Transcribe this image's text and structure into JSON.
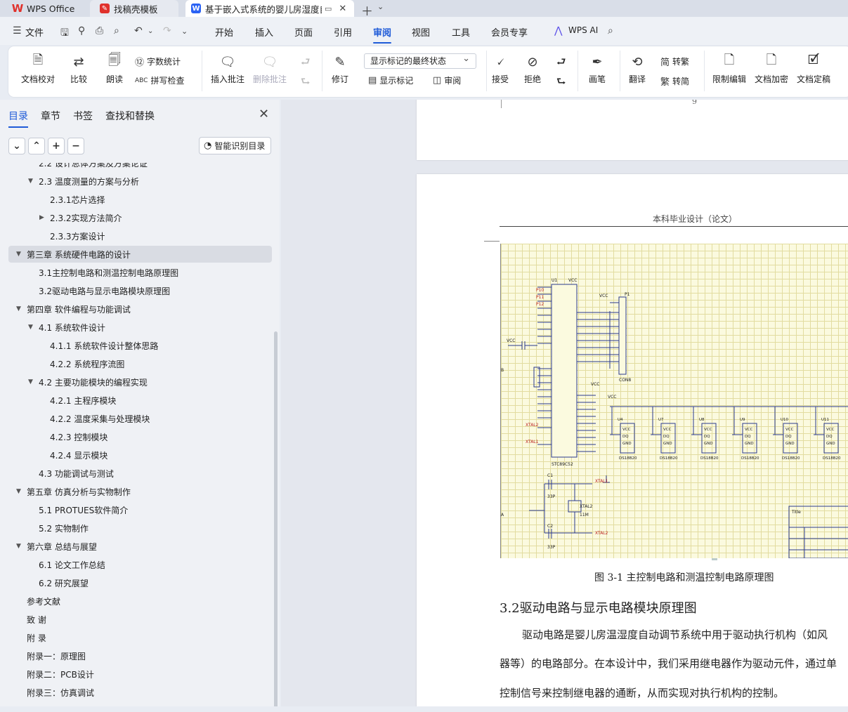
{
  "tabs": {
    "wps": "WPS Office",
    "find": "找稿壳模板",
    "doc": "基于嵌入式系统的婴儿房湿度自动调节系统设计"
  },
  "menu": {
    "file": "文件",
    "items": [
      "开始",
      "插入",
      "页面",
      "引用",
      "审阅",
      "视图",
      "工具",
      "会员专享"
    ],
    "active": "审阅",
    "ai": "WPS AI"
  },
  "ribbon": {
    "doc_check": "文档校对",
    "compare": "比较",
    "read": "朗读",
    "word_count": "字数统计",
    "spell_check": "拼写检查",
    "insert_comment": "插入批注",
    "delete_comment": "删除批注",
    "revise": "修订",
    "mark_state": "显示标记的最终状态",
    "show_marks": "显示标记",
    "review": "审阅",
    "accept": "接受",
    "reject": "拒绝",
    "pen": "画笔",
    "translate": "翻译",
    "to_trad": "转繁",
    "to_simp": "转简",
    "restrict": "限制编辑",
    "encrypt": "文档加密",
    "finalize": "文档定稿"
  },
  "sidebar": {
    "tabs": [
      "目录",
      "章节",
      "书签",
      "查找和替换"
    ],
    "smart_btn": "智能识别目录",
    "toc": [
      {
        "text": "2.2  设计总体方案及方案论证",
        "level": 2
      },
      {
        "text": "2.3  温度测量的方案与分析",
        "level": 2,
        "expand": "down"
      },
      {
        "text": "2.3.1芯片选择",
        "level": 3
      },
      {
        "text": "2.3.2实现方法简介",
        "level": 3,
        "expand": "right"
      },
      {
        "text": "2.3.3方案设计",
        "level": 3
      },
      {
        "text": "第三章  系统硬件电路的设计",
        "level": 1,
        "expand": "down",
        "selected": true
      },
      {
        "text": "3.1主控制电路和测温控制电路原理图",
        "level": 2
      },
      {
        "text": "3.2驱动电路与显示电路模块原理图",
        "level": 2
      },
      {
        "text": "第四章  软件编程与功能调试",
        "level": 1,
        "expand": "down"
      },
      {
        "text": "4.1  系统软件设计",
        "level": 2,
        "expand": "down"
      },
      {
        "text": "4.1.1  系统软件设计整体思路",
        "level": 3
      },
      {
        "text": "4.2.2  系统程序流图",
        "level": 3
      },
      {
        "text": "4.2  主要功能模块的编程实现",
        "level": 2,
        "expand": "down"
      },
      {
        "text": "4.2.1  主程序模块",
        "level": 3
      },
      {
        "text": "4.2.2  温度采集与处理模块",
        "level": 3
      },
      {
        "text": "4.2.3  控制模块",
        "level": 3
      },
      {
        "text": "4.2.4  显示模块",
        "level": 3
      },
      {
        "text": "4.3  功能调试与测试",
        "level": 2
      },
      {
        "text": "第五章  仿真分析与实物制作",
        "level": 1,
        "expand": "down"
      },
      {
        "text": "5.1 PROTUES软件简介",
        "level": 2
      },
      {
        "text": "5.2  实物制作",
        "level": 2
      },
      {
        "text": "第六章  总结与展望",
        "level": 1,
        "expand": "down"
      },
      {
        "text": "6.1  论文工作总结",
        "level": 2
      },
      {
        "text": "6.2  研究展望",
        "level": 2
      },
      {
        "text": "参考文献",
        "level": 1
      },
      {
        "text": "致    谢",
        "level": 1
      },
      {
        "text": "附    录",
        "level": 1
      },
      {
        "text": "附录一：原理图",
        "level": 1
      },
      {
        "text": "附录二：PCB设计",
        "level": 1
      },
      {
        "text": "附录三：仿真调试",
        "level": 1
      }
    ]
  },
  "document": {
    "prev_page_number": "9",
    "header": "本科毕业设计（论文）",
    "figure_caption": "图 3-1 主控制电路和测温控制电路原理图",
    "section_title": "3.2驱动电路与显示电路模块原理图",
    "paragraph_lines": [
      "驱动电路是婴儿房温湿度自动调节系统中用于驱动执行机构（如风",
      "器等）的电路部分。在本设计中，我们采用继电器作为驱动元件，通过单",
      "控制信号来控制继电器的通断，从而实现对执行机构的控制。"
    ],
    "schematic": {
      "mcu_ref": "U1",
      "mcu_name": "STC89C52",
      "vcc": "VCC",
      "xtal1": "XTAL1",
      "xtal2": "XTAL2",
      "crystal": "11M",
      "c1": "C1",
      "c2": "C2",
      "cap_val": "33P",
      "header_ref": "P1",
      "header_name": "CON8",
      "sensor_name": "DS18B20",
      "sensor_refs": [
        "U4",
        "U7",
        "U8",
        "U9",
        "U10",
        "U11"
      ],
      "sensor_pins": [
        "VCC",
        "DQ",
        "GND"
      ],
      "title_block_label": "Title",
      "row_b": "B",
      "row_a": "A"
    }
  }
}
